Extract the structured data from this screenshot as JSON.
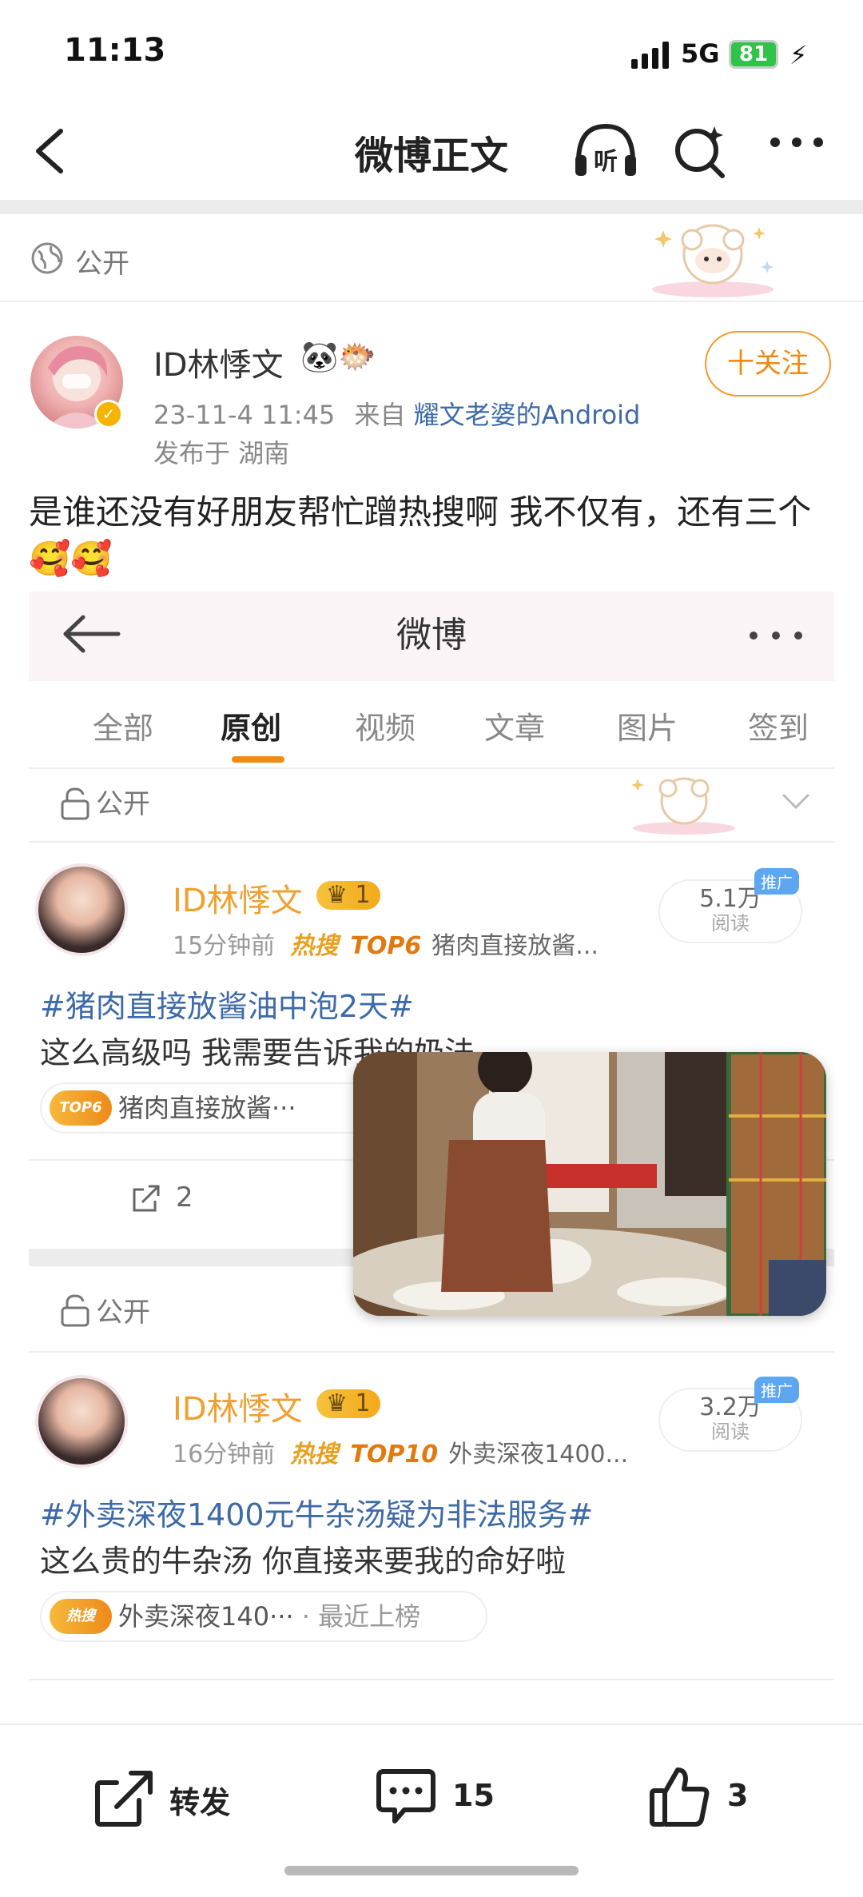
{
  "status_bar": {
    "time": "11:13",
    "network": "5G",
    "battery": "81"
  },
  "nav": {
    "title": "微博正文"
  },
  "visibility": "公开",
  "post": {
    "author": "ID林悸文",
    "timestamp": "23-11-4 11:45",
    "source_prefix": "来自",
    "source": "耀文老婆的Android",
    "location": "发布于 湖南",
    "follow_label": "十关注",
    "text": "是谁还没有好朋友帮忙蹭热搜啊 我不仅有，还有三个🥰🥰"
  },
  "embed": {
    "header_title": "微博",
    "tabs": [
      {
        "label": "全部"
      },
      {
        "label": "原创"
      },
      {
        "label": "视频"
      },
      {
        "label": "文章"
      },
      {
        "label": "图片"
      },
      {
        "label": "签到"
      }
    ],
    "active_tab": "原创",
    "visibility": "公开",
    "posts": [
      {
        "name": "ID林悸文",
        "time": "15分钟前",
        "hot_label": "热搜",
        "rank": "TOP6",
        "topic_short": "猪肉直接放酱...",
        "reads": "5.1万",
        "reads_label": "阅读",
        "promo": "推广",
        "hashtag": "#猪肉直接放酱油中泡2天#",
        "body": "这么高级吗 我需要告诉我的奶法",
        "chip_badge": "TOP6",
        "chip_text": "猪肉直接放酱···",
        "repost_count": "2"
      },
      {
        "name": "ID林悸文",
        "time": "16分钟前",
        "hot_label": "热搜",
        "rank": "TOP10",
        "topic_short": "外卖深夜1400...",
        "reads": "3.2万",
        "reads_label": "阅读",
        "promo": "推广",
        "hashtag": "#外卖深夜1400元牛杂汤疑为非法服务#",
        "body": "这么贵的牛杂汤 你直接来要我的命好啦",
        "chip_badge": "热搜",
        "chip_text": "外卖深夜140···",
        "chip_tail": " · 最近上榜"
      }
    ],
    "crown_level": "1"
  },
  "bottom_bar": {
    "repost_label": "转发",
    "comment_count": "15",
    "like_count": "3"
  }
}
